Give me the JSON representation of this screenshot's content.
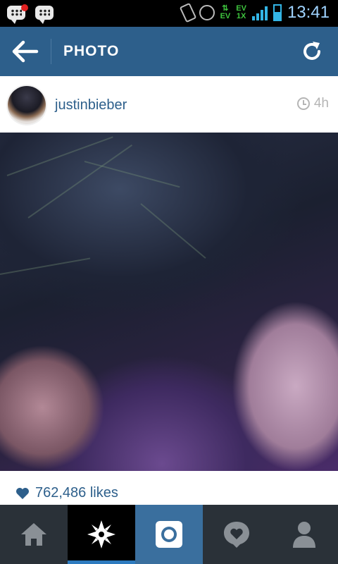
{
  "status_bar": {
    "time": "13:41",
    "icons": [
      "bbm-notification-icon",
      "bbm-icon",
      "vibrate-icon",
      "alarm-icon",
      "data-ev-icon",
      "signal-ev-icon",
      "signal-icon",
      "battery-icon"
    ],
    "ev_top": "EV",
    "ev_bottom": "EV",
    "ev2_top": "EV",
    "ev2_bottom": "1X"
  },
  "app_bar": {
    "title": "PHOTO",
    "back_icon": "arrow-left-icon",
    "refresh_icon": "refresh-icon",
    "color": "#2d5f8b"
  },
  "post": {
    "username": "justinbieber",
    "time_ago": "4h",
    "likes": "762,486 likes"
  },
  "bottom_nav": {
    "tabs": [
      {
        "icon": "home-icon",
        "active": false
      },
      {
        "icon": "explore-icon",
        "active": true
      },
      {
        "icon": "camera-icon",
        "active": false
      },
      {
        "icon": "activity-heart-icon",
        "active": false
      },
      {
        "icon": "profile-icon",
        "active": false
      }
    ],
    "accent": "#2d7bbf"
  }
}
